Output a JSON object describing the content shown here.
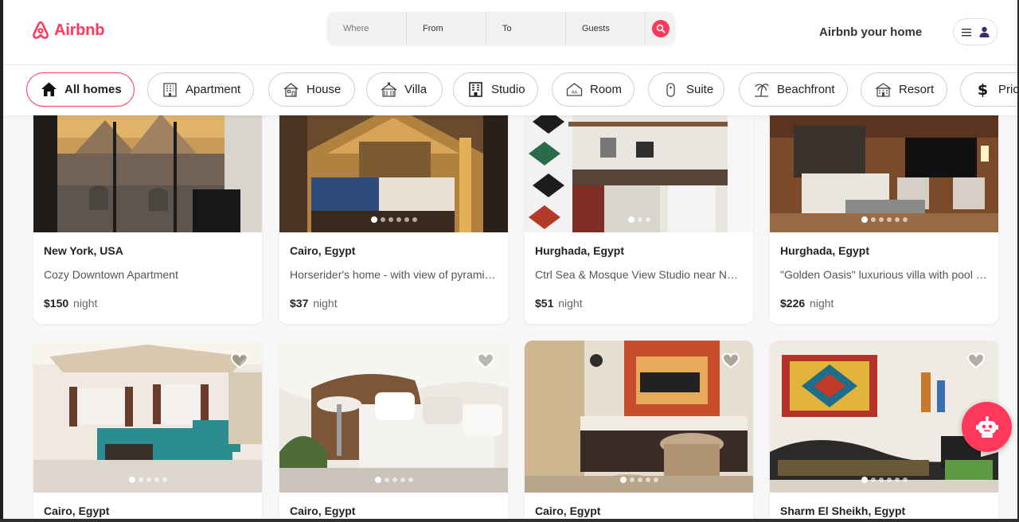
{
  "brand": {
    "name": "Airbnb",
    "color": "#ff385c"
  },
  "search": {
    "where_placeholder": "Where",
    "from_placeholder": "From",
    "to_placeholder": "To",
    "guests_placeholder": "Guests"
  },
  "header": {
    "host_link": "Airbnb your home",
    "menu_icon": "hamburger-icon",
    "user_icon": "user-icon"
  },
  "categories": [
    {
      "label": "All homes",
      "icon": "home-icon",
      "active": true
    },
    {
      "label": "Apartment",
      "icon": "apartment-icon"
    },
    {
      "label": "House",
      "icon": "house-icon"
    },
    {
      "label": "Villa",
      "icon": "villa-icon"
    },
    {
      "label": "Studio",
      "icon": "studio-icon"
    },
    {
      "label": "Room",
      "icon": "room-icon"
    },
    {
      "label": "Suite",
      "icon": "suite-icon"
    },
    {
      "label": "Beachfront",
      "icon": "palm-tree-icon"
    },
    {
      "label": "Resort",
      "icon": "resort-icon"
    },
    {
      "label": "Pric",
      "icon": "dollar-icon"
    }
  ],
  "listings": [
    {
      "location": "New York, USA",
      "title": "Cozy Downtown Apartment",
      "price": "$150",
      "unit": "night"
    },
    {
      "location": "Cairo, Egypt",
      "title": "Horserider's home - with view of pyramid…",
      "price": "$37",
      "unit": "night"
    },
    {
      "location": "Hurghada, Egypt",
      "title": "Ctrl Sea & Mosque View Studio near New …",
      "price": "$51",
      "unit": "night"
    },
    {
      "location": "Hurghada, Egypt",
      "title": "\"Golden Oasis\" luxurious villa with pool & …",
      "price": "$226",
      "unit": "night"
    },
    {
      "location": "Cairo, Egypt"
    },
    {
      "location": "Cairo, Egypt"
    },
    {
      "location": "Cairo, Egypt"
    },
    {
      "location": "Sharm El Sheikh, Egypt"
    }
  ],
  "chat_bot_icon": "robot-icon"
}
